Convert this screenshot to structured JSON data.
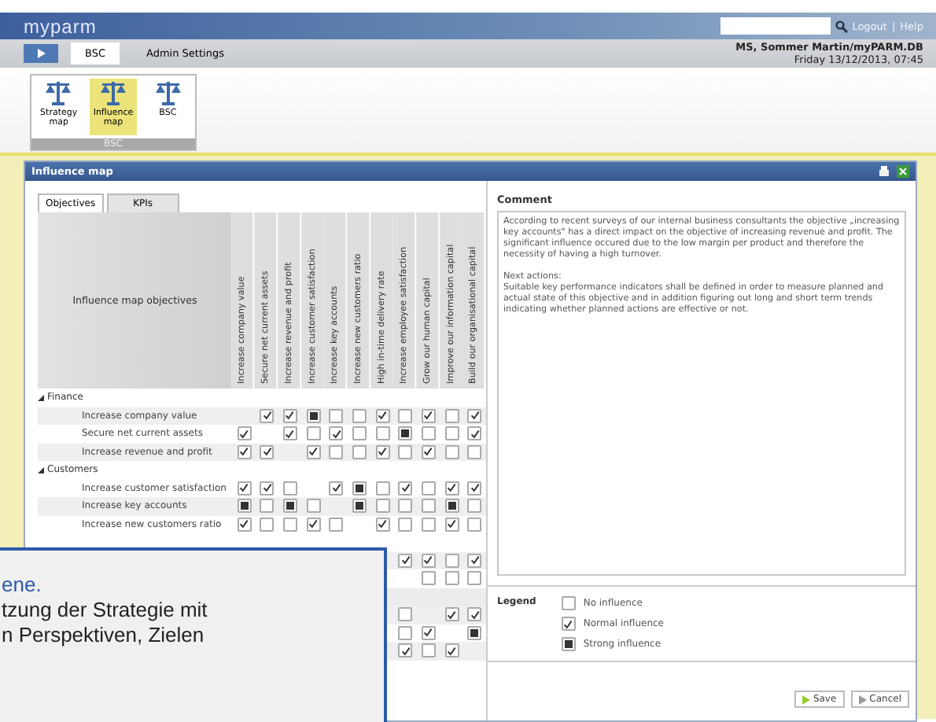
{
  "header": {
    "logo": "myparm",
    "links": [
      "Logout",
      "|",
      "Help"
    ],
    "user": "MS, Sommer Martin/myPARM.DB",
    "date": "Friday 13/12/2013, 07:45"
  },
  "nav": [
    {
      "label": "BSC",
      "selected": true
    },
    {
      "label": "Admin Settings",
      "selected": false
    }
  ],
  "ribbon": {
    "group": "BSC",
    "buttons": [
      {
        "label": "Strategy map",
        "selected": false
      },
      {
        "label": "Influence map",
        "selected": true
      },
      {
        "label": "BSC",
        "selected": false
      }
    ]
  },
  "window": {
    "title": "Influence map"
  },
  "tabs": [
    {
      "label": "Objectives",
      "selected": true
    },
    {
      "label": "KPIs",
      "selected": false
    }
  ],
  "table": {
    "corner": "Influence map objectives",
    "columns": [
      "Increase company value",
      "Secure net current assets",
      "Increase revenue and profit",
      "Increase customer satisfaction",
      "Increase key accounts",
      "Increase new customers ratio",
      "High in-time delivery rate",
      "Increase employee satisfaction",
      "Grow our human capital",
      "Improve our information capital",
      "Build our organisational capital"
    ],
    "groups": [
      {
        "name": "Finance",
        "expanded": true,
        "rows": [
          {
            "label": "Increase company value",
            "cells": [
              null,
              {
                "checked": true,
                "strong": false
              },
              {
                "checked": true,
                "strong": false
              },
              {
                "checked": true,
                "strong": true
              },
              {
                "checked": false
              },
              {
                "checked": false
              },
              {
                "checked": true,
                "strong": false
              },
              {
                "checked": false
              },
              {
                "checked": true,
                "strong": false
              },
              {
                "checked": false
              },
              {
                "checked": true,
                "strong": false
              }
            ]
          },
          {
            "label": "Secure net current assets",
            "cells": [
              {
                "checked": true,
                "strong": false
              },
              null,
              {
                "checked": true,
                "strong": false
              },
              {
                "checked": false
              },
              {
                "checked": true,
                "strong": false
              },
              {
                "checked": false
              },
              {
                "checked": false
              },
              {
                "checked": true,
                "strong": true
              },
              {
                "checked": false
              },
              {
                "checked": false
              },
              {
                "checked": true,
                "strong": false
              }
            ]
          },
          {
            "label": "Increase revenue and profit",
            "cells": [
              {
                "checked": true,
                "strong": false
              },
              {
                "checked": true,
                "strong": false
              },
              null,
              {
                "checked": true,
                "strong": false
              },
              {
                "checked": false
              },
              {
                "checked": false
              },
              {
                "checked": true,
                "strong": false
              },
              {
                "checked": false
              },
              {
                "checked": true,
                "strong": false
              },
              {
                "checked": false
              },
              {
                "checked": false
              }
            ]
          }
        ]
      },
      {
        "name": "Customers",
        "expanded": true,
        "rows": [
          {
            "label": "Increase customer satisfaction",
            "cells": [
              {
                "checked": true,
                "strong": false
              },
              {
                "checked": true,
                "strong": false
              },
              {
                "checked": false
              },
              null,
              {
                "checked": true,
                "strong": false
              },
              {
                "checked": true,
                "strong": true
              },
              {
                "checked": false
              },
              {
                "checked": true,
                "strong": false
              },
              {
                "checked": false
              },
              {
                "checked": true,
                "strong": false
              },
              {
                "checked": true,
                "strong": false
              }
            ]
          },
          {
            "label": "Increase key accounts",
            "cells": [
              {
                "checked": true,
                "strong": true
              },
              {
                "checked": false
              },
              {
                "checked": true,
                "strong": true
              },
              {
                "checked": false
              },
              null,
              {
                "checked": true,
                "strong": true
              },
              {
                "checked": false
              },
              {
                "checked": false
              },
              {
                "checked": false
              },
              {
                "checked": true,
                "strong": true
              },
              {
                "checked": false
              }
            ]
          },
          {
            "label": "Increase new customers ratio",
            "cells": [
              {
                "checked": true,
                "strong": false
              },
              {
                "checked": false
              },
              {
                "checked": false
              },
              {
                "checked": true,
                "strong": false
              },
              {
                "checked": false
              },
              null,
              {
                "checked": true,
                "strong": false
              },
              {
                "checked": false
              },
              {
                "checked": false
              },
              {
                "checked": true,
                "strong": false
              },
              {
                "checked": false
              }
            ]
          }
        ]
      },
      {
        "rows": [
          {
            "cells": [
              null,
              null,
              null,
              null,
              null,
              null,
              null,
              {
                "checked": true,
                "strong": false
              },
              {
                "checked": true,
                "strong": false
              },
              {
                "checked": false
              },
              {
                "checked": true,
                "strong": false
              }
            ]
          },
          {
            "cells": [
              null,
              null,
              null,
              null,
              null,
              null,
              null,
              null,
              {
                "checked": false
              },
              {
                "checked": false
              },
              {
                "checked": false
              }
            ]
          }
        ]
      },
      {
        "rows": [
          {
            "cells": [
              null,
              null,
              null,
              null,
              null,
              null,
              null,
              {
                "checked": false
              },
              null,
              {
                "checked": true,
                "strong": false
              },
              {
                "checked": true,
                "strong": false
              }
            ]
          },
          {
            "cells": [
              null,
              null,
              null,
              null,
              null,
              null,
              null,
              {
                "checked": false
              },
              {
                "checked": true,
                "strong": false
              },
              null,
              {
                "checked": true,
                "strong": true
              }
            ]
          },
          {
            "cells": [
              null,
              null,
              null,
              null,
              null,
              null,
              null,
              {
                "checked": true,
                "strong": false
              },
              {
                "checked": false
              },
              {
                "checked": true,
                "strong": false
              },
              null
            ]
          }
        ]
      }
    ]
  },
  "comment": {
    "label": "Comment",
    "paragraphs": [
      "According to recent surveys of our internal business consultants the objective „increasing key accounts\" has a direct impact on the objective of increasing revenue and profit. The significant influence occured due to the low margin per product and therefore the necessity of having a high turnover.",
      "Next actions:\nSuitable key performance indicators shall be defined in order to measure planned and actual state of this objective and in addition figuring out long and short term trends indicating whether planned actions are effective or not."
    ]
  },
  "legend": {
    "title": "Legend",
    "items": [
      {
        "label": "No influence",
        "checked": false
      },
      {
        "label": "Normal influence",
        "checked": true,
        "strong": false
      },
      {
        "label": "Strong influence",
        "checked": true,
        "strong": true
      }
    ]
  },
  "buttons": [
    "Save",
    "Cancel"
  ],
  "popup": {
    "heading": "ene.",
    "lines": [
      "tzung der Strategie mit",
      "n Perspektiven, Zielen"
    ]
  }
}
